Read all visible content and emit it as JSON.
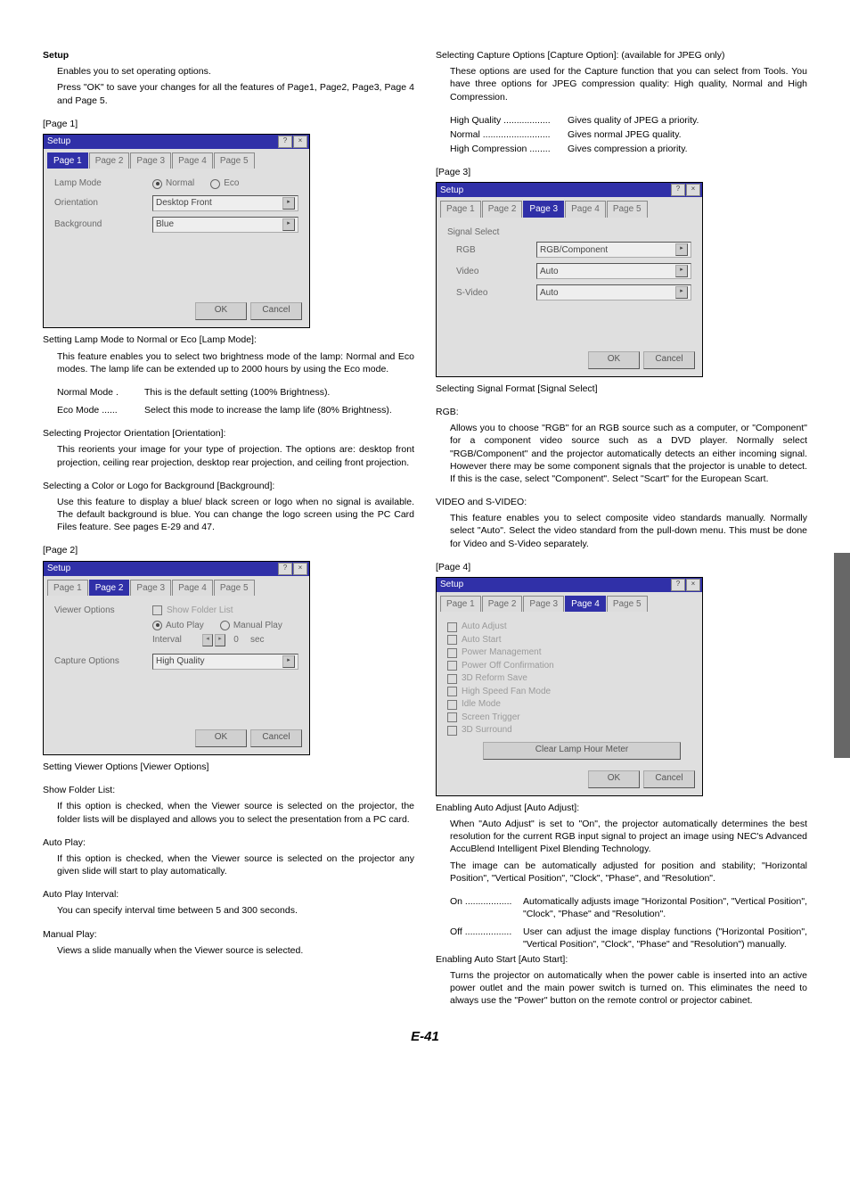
{
  "footer": "E-41",
  "left": {
    "setup_title": "Setup",
    "setup_desc1": "Enables you to set operating options.",
    "setup_desc2": "Press \"OK\" to save your changes for all the features of Page1, Page2, Page3, Page 4 and Page 5.",
    "page1_label": "[Page 1]",
    "dlg1": {
      "title": "Setup",
      "tabs": [
        "Page 1",
        "Page 2",
        "Page 3",
        "Page 4",
        "Page 5"
      ],
      "active": 0,
      "lamp_mode": "Lamp Mode",
      "normal": "Normal",
      "eco": "Eco",
      "orientation_lbl": "Orientation",
      "orientation_val": "Desktop Front",
      "background_lbl": "Background",
      "background_val": "Blue",
      "ok": "OK",
      "cancel": "Cancel"
    },
    "lamp_title": "Setting Lamp Mode to Normal or Eco [Lamp Mode]:",
    "lamp_body": "This feature enables you to select two brightness mode of the lamp: Normal and Eco modes. The lamp life can be extended up to 2000 hours by using the Eco mode.",
    "normal_mode_term": "Normal Mode .",
    "normal_mode_body": "This is the default setting (100% Brightness).",
    "eco_mode_term": "Eco Mode ......",
    "eco_mode_body": "Select this mode to increase the lamp life (80% Brightness).",
    "orient_title": "Selecting Projector Orientation [Orientation]:",
    "orient_body": "This reorients your image for your type of projection. The options are: desktop front projection, ceiling rear projection, desktop rear projection, and ceiling front projection.",
    "bg_title": "Selecting a Color or Logo for Background [Background]:",
    "bg_body": "Use this feature to display a blue/ black screen or logo when no signal is available. The default background is blue. You can change the logo screen using the PC Card Files feature. See pages E-29 and 47.",
    "page2_label": "[Page 2]",
    "dlg2": {
      "title": "Setup",
      "tabs": [
        "Page 1",
        "Page 2",
        "Page 3",
        "Page 4",
        "Page 5"
      ],
      "active": 1,
      "viewer_options": "Viewer Options",
      "show_folder": "Show Folder List",
      "auto_play": "Auto Play",
      "manual_play": "Manual Play",
      "interval": "Interval",
      "interval_val": "0",
      "interval_unit": "sec",
      "capture_options": "Capture Options",
      "capture_val": "High Quality",
      "ok": "OK",
      "cancel": "Cancel"
    },
    "viewer_title": "Setting Viewer Options [Viewer Options]",
    "show_folder_title": "Show Folder List:",
    "show_folder_body": "If this option is checked, when the Viewer source is selected on the projector, the folder lists will be displayed and allows you to select the presentation from a PC card.",
    "autoplay_title": "Auto Play:",
    "autoplay_body": "If this option is checked, when the Viewer source is selected on the projector any given slide will start to play automatically.",
    "autoplayint_title": "Auto Play Interval:",
    "autoplayint_body": "You can specify interval time between 5 and 300 seconds.",
    "manual_title": "Manual Play:",
    "manual_body": "Views a slide manually when the Viewer source is selected."
  },
  "right": {
    "capture_title": "Selecting Capture Options [Capture Option]: (available for JPEG only)",
    "capture_body": "These options are used for the Capture function that you can select from Tools. You have three options for JPEG compression quality: High quality, Normal and High Compression.",
    "hq_term": "High Quality ..................",
    "hq_body": "Gives quality of JPEG a priority.",
    "normal_term": "Normal ..........................",
    "normal_body": "Gives normal JPEG quality.",
    "hc_term": "High Compression ........",
    "hc_body": "Gives compression a priority.",
    "page3_label": "[Page 3]",
    "dlg3": {
      "title": "Setup",
      "tabs": [
        "Page 1",
        "Page 2",
        "Page 3",
        "Page 4",
        "Page 5"
      ],
      "active": 2,
      "signal_select": "Signal Select",
      "rgb_lbl": "RGB",
      "rgb_val": "RGB/Component",
      "video_lbl": "Video",
      "video_val": "Auto",
      "svideo_lbl": "S-Video",
      "svideo_val": "Auto",
      "ok": "OK",
      "cancel": "Cancel"
    },
    "signal_title": "Selecting Signal Format [Signal Select]",
    "rgb_title": "RGB:",
    "rgb_body": "Allows you to choose \"RGB\" for an RGB source such as a computer, or \"Component\" for a component video source such as a DVD player. Normally select \"RGB/Component\" and the projector automatically detects an either incoming signal. However there may be some component signals that the projector is unable to detect. If this is the case, select \"Component\". Select \"Scart\" for the European Scart.",
    "vsv_title": "VIDEO and S-VIDEO:",
    "vsv_body": "This feature enables you to select composite video standards manually. Normally select \"Auto\". Select the video standard from the pull-down menu. This must be done for Video and S-Video separately.",
    "page4_label": "[Page 4]",
    "dlg4": {
      "title": "Setup",
      "tabs": [
        "Page 1",
        "Page 2",
        "Page 3",
        "Page 4",
        "Page 5"
      ],
      "active": 3,
      "checks": [
        "Auto Adjust",
        "Auto Start",
        "Power Management",
        "Power Off Confirmation",
        "3D Reform Save",
        "High Speed Fan Mode",
        "Idle Mode",
        "Screen Trigger",
        "3D Surround"
      ],
      "clear": "Clear Lamp Hour Meter",
      "ok": "OK",
      "cancel": "Cancel"
    },
    "auto_title": "Enabling Auto Adjust [Auto Adjust]:",
    "auto_body1": "When \"Auto Adjust\" is set to \"On\", the projector automatically determines the best resolution for the current RGB input signal to project an image using NEC's Advanced AccuBlend Intelligent Pixel Blending Technology.",
    "auto_body2": "The image can be automatically adjusted for position and stability; \"Horizontal Position\", \"Vertical Position\", \"Clock\", \"Phase\", and \"Resolution\".",
    "on_term": "On ..................",
    "on_body": "Automatically adjusts image \"Horizontal Position\", \"Vertical Position\", \"Clock\", \"Phase\" and \"Resolution\".",
    "off_term": "Off ..................",
    "off_body": "User can adjust the image display functions (\"Horizontal Position\", \"Vertical Position\", \"Clock\", \"Phase\" and \"Resolution\") manually.",
    "autostart_title": "Enabling Auto Start [Auto Start]:",
    "autostart_body": "Turns the projector on automatically when the power cable is inserted into an active power outlet and the main power switch is turned on. This eliminates the need to always use the \"Power\" button on the remote control or projector cabinet."
  }
}
